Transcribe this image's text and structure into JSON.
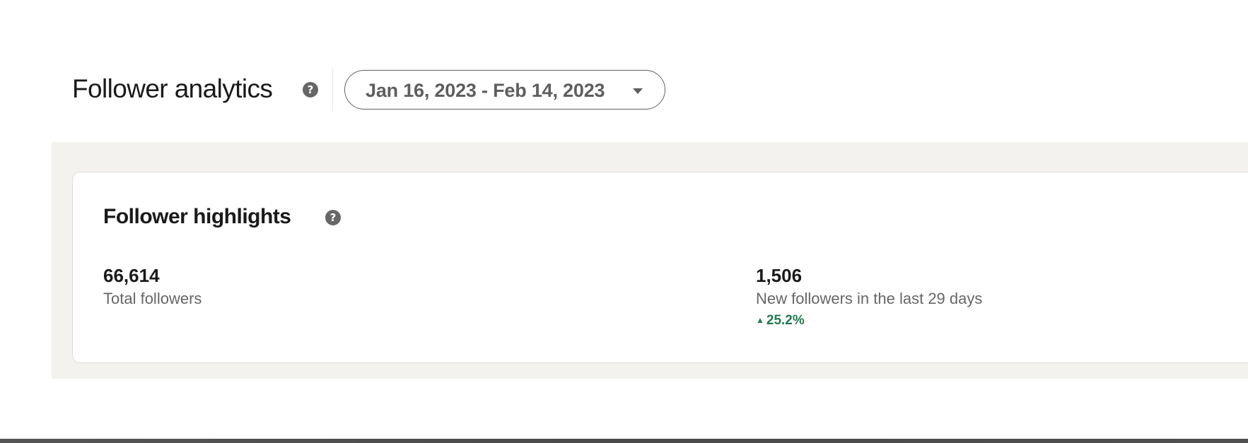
{
  "header": {
    "title": "Follower analytics",
    "help_icon": "?",
    "date_range": {
      "label": "Jan 16, 2023 - Feb 14, 2023",
      "icon": "caret-down-icon"
    }
  },
  "highlights": {
    "title": "Follower highlights",
    "help_icon": "?",
    "stats": [
      {
        "value": "66,614",
        "label": "Total followers"
      },
      {
        "value": "1,506",
        "label": "New followers in the last 29 days",
        "change": {
          "direction": "up",
          "arrow": "▲",
          "value": "25.2%",
          "color": "#237a50"
        }
      }
    ]
  },
  "colors": {
    "panel_background": "#f3f2ef",
    "positive": "#237a50"
  }
}
